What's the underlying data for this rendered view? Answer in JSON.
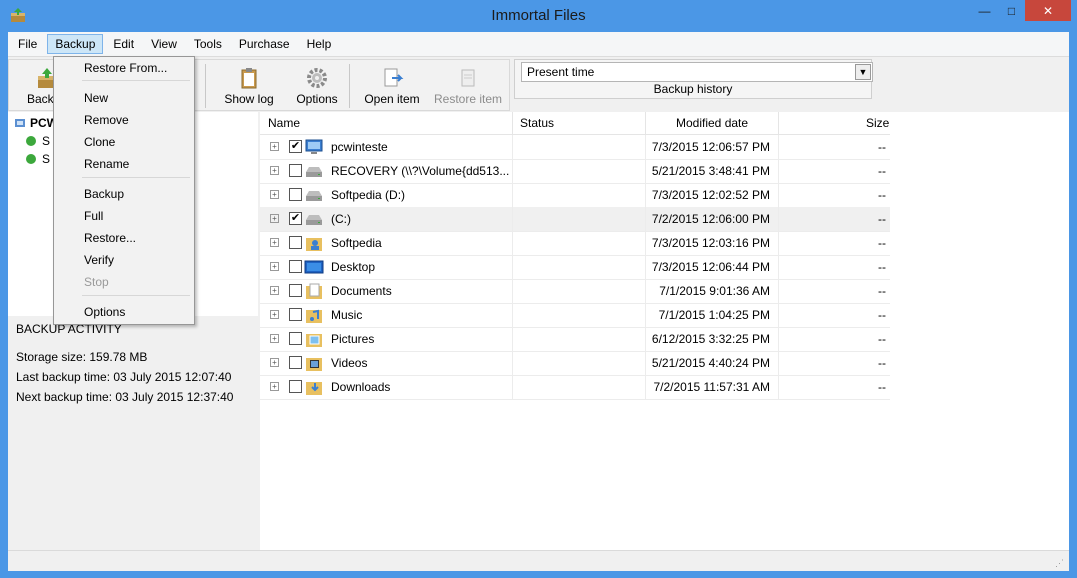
{
  "window": {
    "title": "Immortal Files",
    "minimize": "—",
    "maximize": "□",
    "close": "✕"
  },
  "menu": {
    "items": [
      "File",
      "Backup",
      "Edit",
      "View",
      "Tools",
      "Purchase",
      "Help"
    ],
    "active": "Backup"
  },
  "dropdown": {
    "items": [
      {
        "label": "Restore From...",
        "enabled": true
      },
      {
        "label": "New",
        "enabled": true
      },
      {
        "label": "Remove",
        "enabled": true
      },
      {
        "label": "Clone",
        "enabled": true
      },
      {
        "label": "Rename",
        "enabled": true
      },
      {
        "label": "Backup",
        "enabled": true
      },
      {
        "label": "Full",
        "enabled": true
      },
      {
        "label": "Restore...",
        "enabled": true
      },
      {
        "label": "Verify",
        "enabled": true
      },
      {
        "label": "Stop",
        "enabled": false
      },
      {
        "label": "Options",
        "enabled": true
      }
    ]
  },
  "toolbar": {
    "backup_label": "Backup",
    "show_log_label": "Show log",
    "options_label": "Options",
    "open_item_label": "Open item",
    "restore_item_label": "Restore item",
    "history_value": "Present time",
    "history_label": "Backup history"
  },
  "tree": {
    "root": "PCW",
    "children": [
      "S",
      "S"
    ]
  },
  "activity": {
    "heading": "BACKUP ACTIVITY",
    "storage": "Storage size: 159.78 MB",
    "last": "Last backup time: 03 July 2015 12:07:40",
    "next": "Next backup time: 03 July 2015 12:37:40"
  },
  "columns": {
    "name": "Name",
    "status": "Status",
    "modified": "Modified date",
    "size": "Size"
  },
  "files": [
    {
      "name": "pcwinteste",
      "checked": true,
      "icon": "computer-icon",
      "date": "7/3/2015 12:06:57 PM",
      "size": "--"
    },
    {
      "name": "RECOVERY (\\\\?\\Volume{dd513...",
      "checked": false,
      "icon": "drive-icon",
      "date": "5/21/2015 3:48:41 PM",
      "size": "--"
    },
    {
      "name": "Softpedia (D:)",
      "checked": false,
      "icon": "drive-icon",
      "date": "7/3/2015 12:02:52 PM",
      "size": "--"
    },
    {
      "name": "(C:)",
      "checked": true,
      "icon": "drive-icon",
      "date": "7/2/2015 12:06:00 PM",
      "size": "--"
    },
    {
      "name": "Softpedia",
      "checked": false,
      "icon": "user-folder-icon",
      "date": "7/3/2015 12:03:16 PM",
      "size": "--"
    },
    {
      "name": "Desktop",
      "checked": false,
      "icon": "desktop-icon",
      "date": "7/3/2015 12:06:44 PM",
      "size": "--"
    },
    {
      "name": "Documents",
      "checked": false,
      "icon": "documents-folder-icon",
      "date": "7/1/2015 9:01:36 AM",
      "size": "--"
    },
    {
      "name": "Music",
      "checked": false,
      "icon": "music-folder-icon",
      "date": "7/1/2015 1:04:25 PM",
      "size": "--"
    },
    {
      "name": "Pictures",
      "checked": false,
      "icon": "pictures-folder-icon",
      "date": "6/12/2015 3:32:25 PM",
      "size": "--"
    },
    {
      "name": "Videos",
      "checked": false,
      "icon": "videos-folder-icon",
      "date": "5/21/2015 4:40:24 PM",
      "size": "--"
    },
    {
      "name": "Downloads",
      "checked": false,
      "icon": "downloads-folder-icon",
      "date": "7/2/2015 11:57:31 AM",
      "size": "--"
    }
  ],
  "selected_row": 3
}
